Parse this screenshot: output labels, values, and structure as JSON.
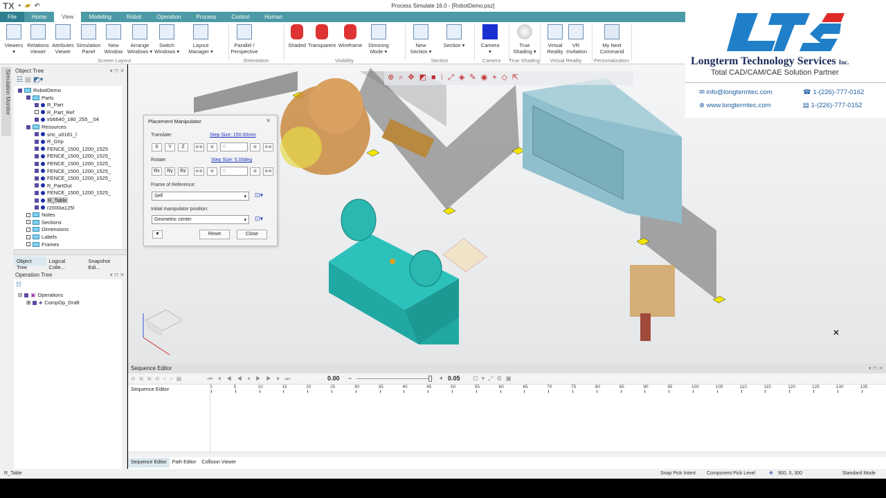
{
  "title": "Process Simulate 16.0 - [RobotDemo.psz]",
  "app_logo": "TX",
  "tabs": [
    "File",
    "Home",
    "View",
    "Modeling",
    "Robot",
    "Operation",
    "Process",
    "Control",
    "Human"
  ],
  "active_tab": "View",
  "ribbon": {
    "buttons": [
      {
        "label": "Viewers ▾",
        "icon": "viewers-icon"
      },
      {
        "label": "Relations Viewer",
        "icon": "relations-icon"
      },
      {
        "label": "Attributes Viewer",
        "icon": "attributes-icon"
      },
      {
        "label": "Simulation Panel",
        "icon": "simulation-panel-icon"
      },
      {
        "label": "New Window",
        "icon": "new-window-icon"
      },
      {
        "label": "Arrange Windows ▾",
        "icon": "arrange-windows-icon"
      },
      {
        "label": "Switch Windows ▾",
        "icon": "switch-windows-icon"
      },
      {
        "label": "Layout Manager ▾",
        "icon": "layout-manager-icon"
      },
      {
        "label": "Parallel / Perspective",
        "icon": "perspective-icon"
      },
      {
        "label": "Shaded",
        "icon": "shaded-icon"
      },
      {
        "label": "Transparent",
        "icon": "transparent-icon"
      },
      {
        "label": "Wireframe",
        "icon": "wireframe-icon"
      },
      {
        "label": "Dimming Mode ▾",
        "icon": "dimming-icon"
      },
      {
        "label": "New Section ▾",
        "icon": "new-section-icon"
      },
      {
        "label": "Section ▾",
        "icon": "section-icon"
      },
      {
        "label": "Camera ▾",
        "icon": "camera-icon"
      },
      {
        "label": "True Shading ▾",
        "icon": "true-shading-icon"
      },
      {
        "label": "Virtual Reality",
        "icon": "vr-headset-icon"
      },
      {
        "label": "VR Invitation",
        "icon": "vr-invitation-icon"
      },
      {
        "label": "My Next Command",
        "icon": "my-next-command-icon"
      }
    ],
    "groups": [
      "Screen Layout",
      "Orientation",
      "Visibility",
      "Section",
      "Camera",
      "True Shading",
      "Virtual Reality",
      "Personalization"
    ]
  },
  "side_strip": "Simulation Monitor",
  "object_tree": {
    "title": "Object Tree",
    "nodes": [
      {
        "label": "RobotDemo",
        "level": 0
      },
      {
        "label": "Parts",
        "level": 1
      },
      {
        "label": "R_Part",
        "level": 2
      },
      {
        "label": "R_Part_Ref",
        "level": 2
      },
      {
        "label": "irb6640_180_255__04",
        "level": 2
      },
      {
        "label": "Resources",
        "level": 1
      },
      {
        "label": "srtc_u0181_l",
        "level": 2
      },
      {
        "label": "R_Grip",
        "level": 2
      },
      {
        "label": "FENCE_1500_1200_1525",
        "level": 2
      },
      {
        "label": "FENCE_1500_1200_1525_",
        "level": 2
      },
      {
        "label": "FENCE_1500_1200_1525_",
        "level": 2
      },
      {
        "label": "FENCE_1500_1200_1525_",
        "level": 2
      },
      {
        "label": "FENCE_1500_1200_1525_",
        "level": 2
      },
      {
        "label": "R_PartOut",
        "level": 2
      },
      {
        "label": "FENCE_1500_1200_1525_",
        "level": 2
      },
      {
        "label": "R_Table",
        "level": 2,
        "selected": true
      },
      {
        "label": "r2000ia125l",
        "level": 2
      },
      {
        "label": "Notes",
        "level": 1
      },
      {
        "label": "Sections",
        "level": 1
      },
      {
        "label": "Dimensions",
        "level": 1
      },
      {
        "label": "Labels",
        "level": 1
      },
      {
        "label": "Frames",
        "level": 1
      }
    ],
    "bottom_tabs": [
      "Object Tree",
      "Logical Colle...",
      "Snapshot Edi..."
    ]
  },
  "operation_tree": {
    "title": "Operation Tree",
    "nodes": [
      {
        "label": "Operations"
      },
      {
        "label": "CompOp_Draft"
      }
    ]
  },
  "dialog": {
    "title": "Placement Manipulator",
    "translate_label": "Translate:",
    "translate_step": "Step Size: 150.00mm",
    "translate_axes": [
      "X",
      "Y",
      "Z"
    ],
    "translate_value": "0",
    "rotate_label": "Rotate:",
    "rotate_step": "Step Size: 5.00deg",
    "rotate_axes": [
      "Rx",
      "Ry",
      "Rz"
    ],
    "rotate_value": "0",
    "frame_label": "Frame of Reference:",
    "frame_value": "Self",
    "initial_label": "Initial manipulator position:",
    "initial_value": "Geometric center",
    "reset": "Reset",
    "close": "Close"
  },
  "sequence_editor": {
    "title": "Sequence Editor",
    "column": "Sequence Editor",
    "time": "0.00",
    "step": "0.05",
    "ruler": [
      "0",
      "5",
      "10",
      "15",
      "20",
      "25",
      "30",
      "35",
      "40",
      "45",
      "50",
      "55",
      "60",
      "65",
      "70",
      "75",
      "80",
      "85",
      "90",
      "95",
      "100",
      "105",
      "110",
      "115",
      "120",
      "125",
      "130",
      "135"
    ],
    "bottom_tabs": [
      "Sequence Editor",
      "Path Editor",
      "Collision Viewer"
    ]
  },
  "status": {
    "selection": "R_Table",
    "snap": "Snap Pick Intent",
    "pick_level": "Component Pick Level",
    "coords": "900, 0, 300",
    "mode": "Standard Mode"
  },
  "logo": {
    "mark": "LTS",
    "company": "Longterm Technology Services",
    "suffix": "Inc.",
    "tagline": "Total CAD/CAM/CAE Solution Partner",
    "email": "info@longtermtec.com",
    "web": "www.longtermtec.com",
    "phone": "1-(226)-777-0162",
    "fax": "1-(226)-777-0152",
    "blue": "#1f7fc8",
    "red": "#e02a2a"
  },
  "colors": {
    "tab_bar": "#4c9aa5",
    "table": "#2bb5b0",
    "fence": "#f2e600",
    "box": "#8fbfcc"
  }
}
